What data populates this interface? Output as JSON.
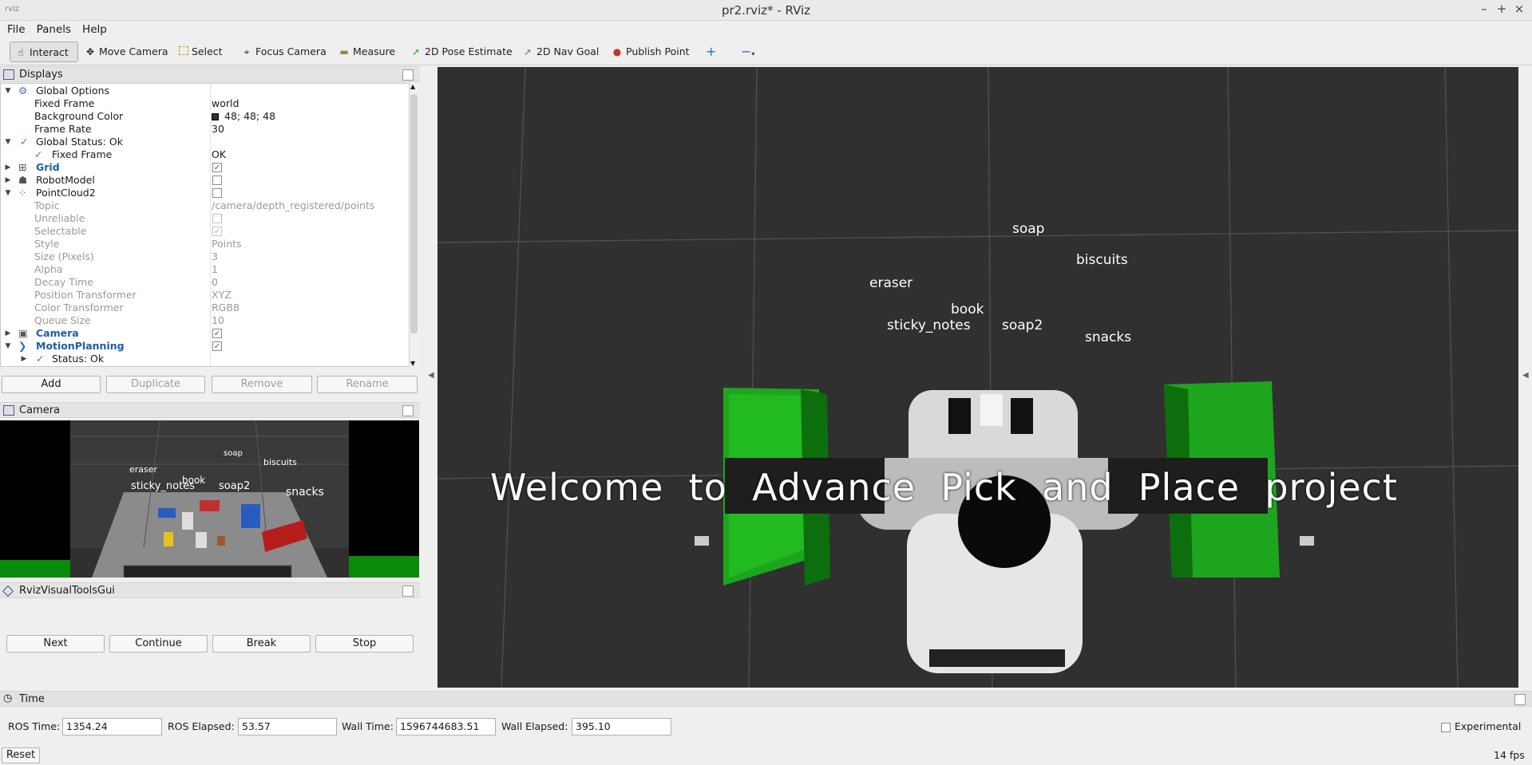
{
  "window": {
    "title": "pr2.rviz* - RViz",
    "logo": "rviz"
  },
  "menu": [
    "File",
    "Panels",
    "Help"
  ],
  "toolbar": [
    {
      "label": "Interact",
      "icon": "cursor-icon"
    },
    {
      "label": "Move Camera",
      "icon": "move-camera-icon"
    },
    {
      "label": "Select",
      "icon": "select-icon"
    },
    {
      "label": "Focus Camera",
      "icon": "focus-camera-icon"
    },
    {
      "label": "Measure",
      "icon": "ruler-icon"
    },
    {
      "label": "2D Pose Estimate",
      "icon": "green-arrow-icon"
    },
    {
      "label": "2D Nav Goal",
      "icon": "green-arrow-icon"
    },
    {
      "label": "Publish Point",
      "icon": "map-pin-icon"
    }
  ],
  "displays": {
    "title": "Displays",
    "rows": [
      {
        "name": "Global Options",
        "value": ""
      },
      {
        "name": "Fixed Frame",
        "value": "world"
      },
      {
        "name": "Background Color",
        "value": "48; 48; 48"
      },
      {
        "name": "Frame Rate",
        "value": "30"
      },
      {
        "name": "Global Status: Ok",
        "value": ""
      },
      {
        "name": "Fixed Frame",
        "value": "OK"
      },
      {
        "name": "Grid",
        "value": ""
      },
      {
        "name": "RobotModel",
        "value": ""
      },
      {
        "name": "PointCloud2",
        "value": ""
      },
      {
        "name": "Topic",
        "value": "/camera/depth_registered/points"
      },
      {
        "name": "Unreliable",
        "value": ""
      },
      {
        "name": "Selectable",
        "value": ""
      },
      {
        "name": "Style",
        "value": "Points"
      },
      {
        "name": "Size (Pixels)",
        "value": "3"
      },
      {
        "name": "Alpha",
        "value": "1"
      },
      {
        "name": "Decay Time",
        "value": "0"
      },
      {
        "name": "Position Transformer",
        "value": "XYZ"
      },
      {
        "name": "Color Transformer",
        "value": "RGB8"
      },
      {
        "name": "Queue Size",
        "value": "10"
      },
      {
        "name": "Camera",
        "value": ""
      },
      {
        "name": "MotionPlanning",
        "value": ""
      },
      {
        "name": "Status: Ok",
        "value": ""
      }
    ],
    "buttons": [
      "Add",
      "Duplicate",
      "Remove",
      "Rename"
    ],
    "bg_color": "#303030"
  },
  "camera_panel": {
    "title": "Camera",
    "labels": [
      "soap",
      "biscuits",
      "eraser",
      "book",
      "sticky_notes",
      "soap2",
      "snacks"
    ]
  },
  "rviz_tools": {
    "title": "RvizVisualToolsGui",
    "buttons": [
      "Next",
      "Continue",
      "Break",
      "Stop"
    ]
  },
  "viewport": {
    "labels": [
      "soap",
      "biscuits",
      "eraser",
      "book",
      "sticky_notes",
      "soap2",
      "snacks"
    ],
    "welcome": "Welcome  to  Advance  Pick  and  Place  project"
  },
  "time_panel": {
    "title": "Time",
    "ros_time_label": "ROS Time:",
    "ros_time": "1354.24",
    "ros_elapsed_label": "ROS Elapsed:",
    "ros_elapsed": "53.57",
    "wall_time_label": "Wall Time:",
    "wall_time": "1596744683.51",
    "wall_elapsed_label": "Wall Elapsed:",
    "wall_elapsed": "395.10",
    "experimental": "Experimental",
    "reset": "Reset",
    "fps": "14 fps"
  }
}
